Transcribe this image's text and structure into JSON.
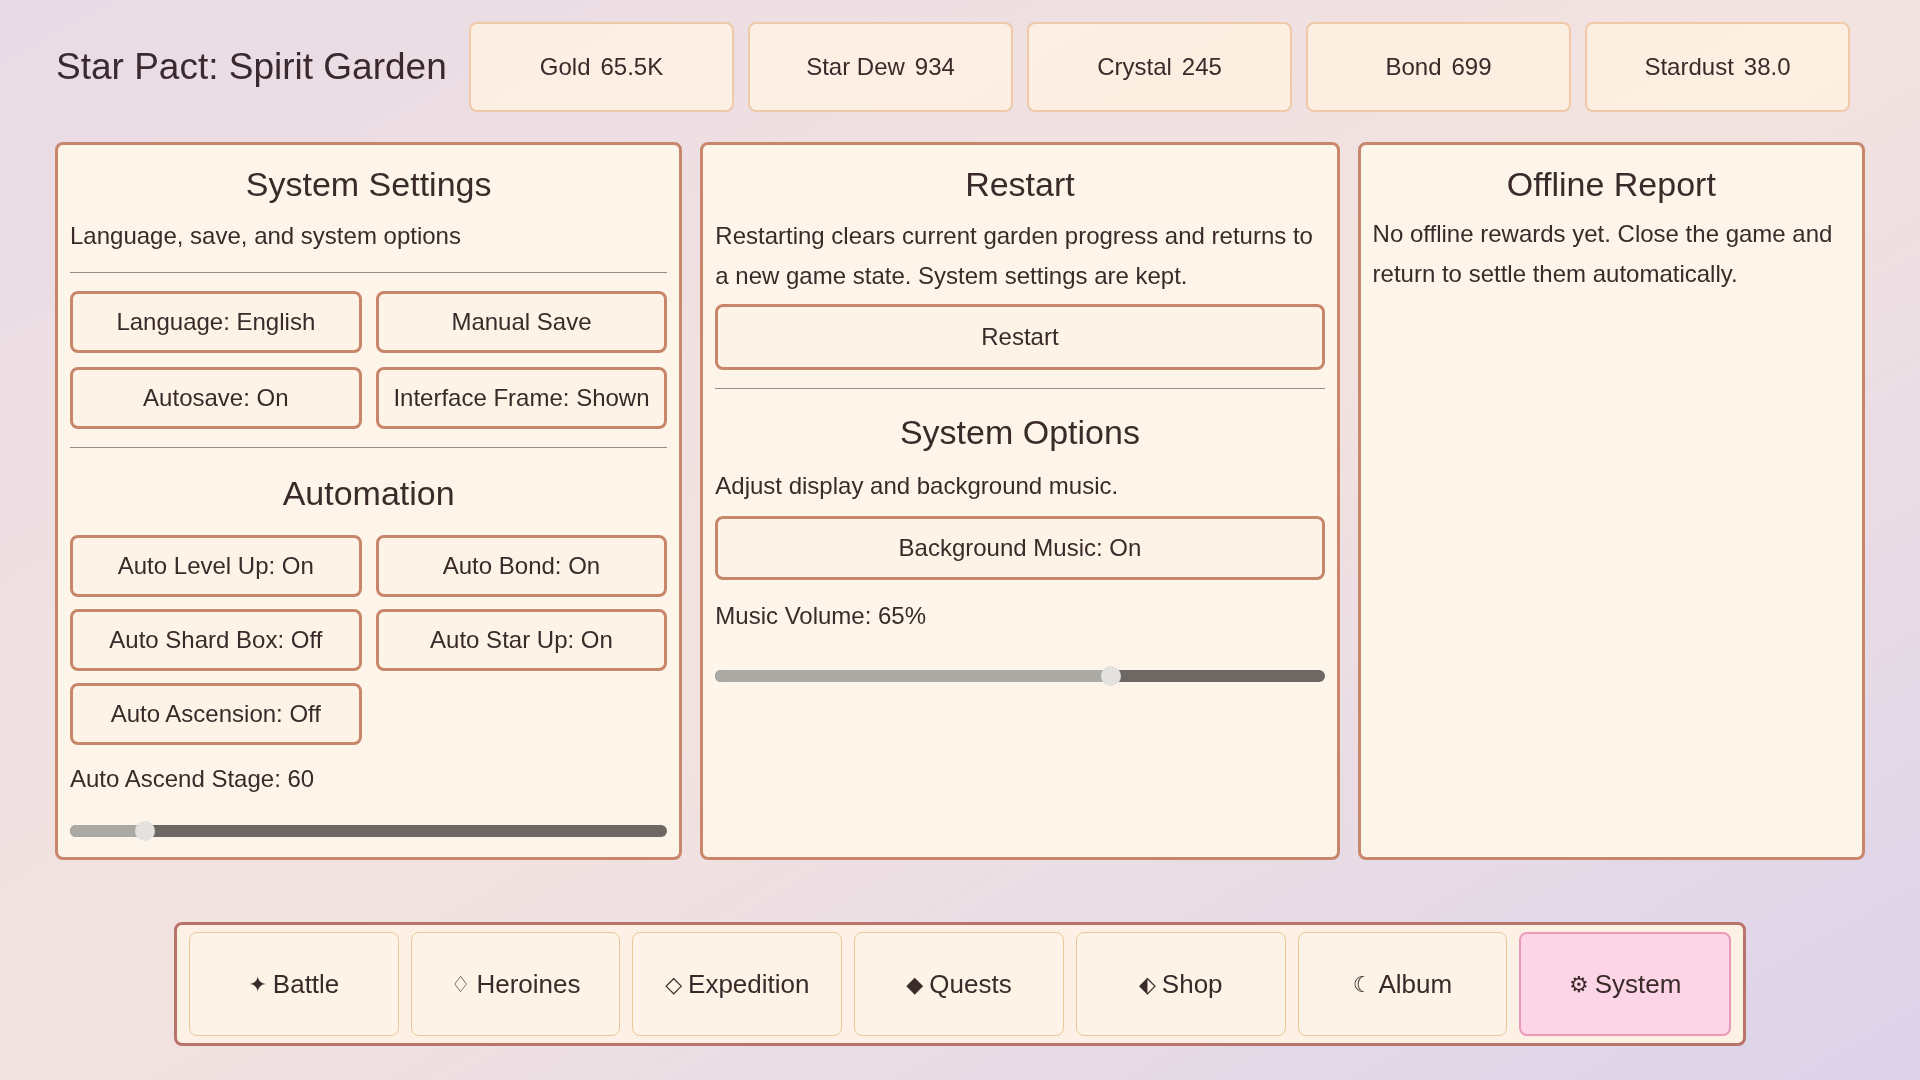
{
  "title": "Star Pact: Spirit Garden",
  "resources": [
    {
      "label": "Gold",
      "value": "65.5K"
    },
    {
      "label": "Star Dew",
      "value": "934"
    },
    {
      "label": "Crystal",
      "value": "245"
    },
    {
      "label": "Bond",
      "value": "699"
    },
    {
      "label": "Stardust",
      "value": "38.0"
    }
  ],
  "system_settings": {
    "title": "System Settings",
    "subtitle": "Language, save, and system options",
    "buttons": [
      "Language: English",
      "Manual Save",
      "Autosave: On",
      "Interface Frame: Shown"
    ]
  },
  "automation": {
    "title": "Automation",
    "buttons": [
      "Auto Level Up: On",
      "Auto Bond: On",
      "Auto Shard Box: Off",
      "Auto Star Up: On",
      "Auto Ascension: Off"
    ],
    "slider": {
      "label": "Auto Ascend Stage: 60",
      "level": 0.125
    }
  },
  "restart": {
    "title": "Restart",
    "description": "Restarting clears current garden progress and returns to a new game state. System settings are kept.",
    "button": "Restart"
  },
  "system_options": {
    "title": "System Options",
    "description": "Adjust display and background music.",
    "button": "Background Music: On",
    "slider": {
      "label": "Music Volume: 65%",
      "level": 0.65
    }
  },
  "offline_report": {
    "title": "Offline Report",
    "text": "No offline rewards yet. Close the game and return to settle them automatically."
  },
  "nav": [
    {
      "icon": "✦",
      "label": "Battle",
      "selected": false
    },
    {
      "icon": "♢",
      "label": "Heroines",
      "selected": false
    },
    {
      "icon": "◇",
      "label": "Expedition",
      "selected": false
    },
    {
      "icon": "◆",
      "label": "Quests",
      "selected": false
    },
    {
      "icon": "⬖",
      "label": "Shop",
      "selected": false
    },
    {
      "icon": "☾",
      "label": "Album",
      "selected": false
    },
    {
      "icon": "⚙",
      "label": "System",
      "selected": true
    }
  ]
}
